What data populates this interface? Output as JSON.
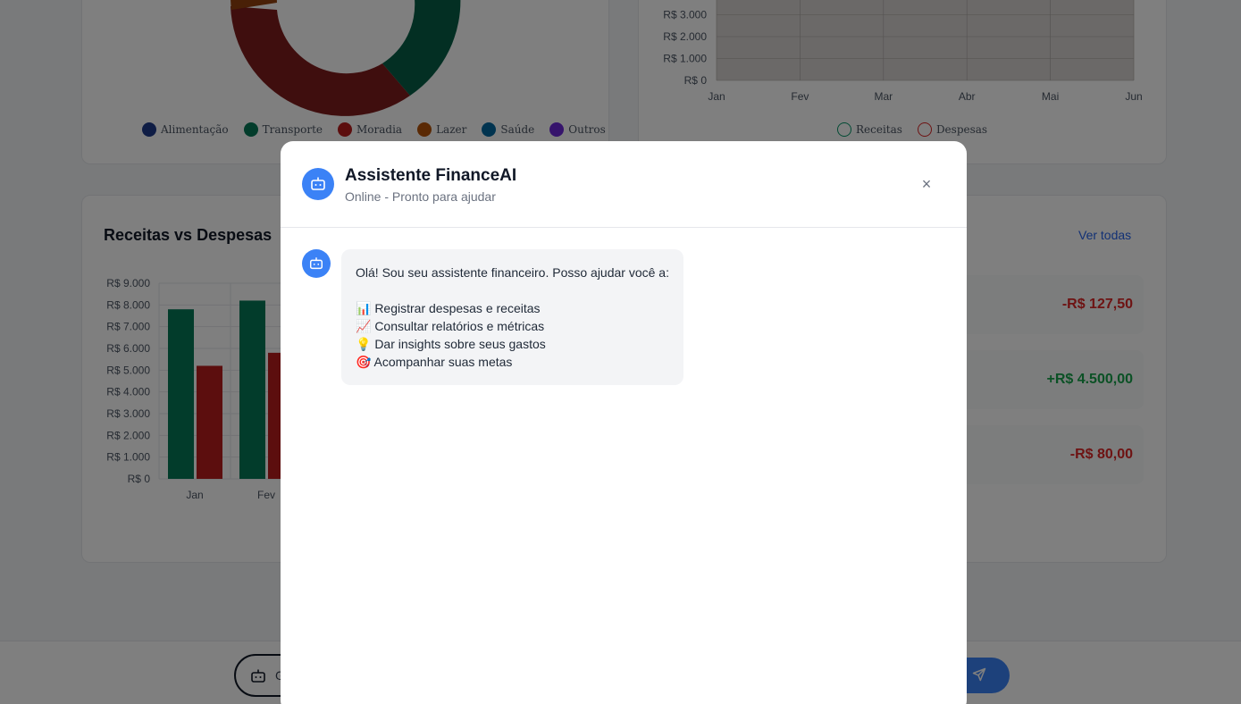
{
  "donut_chart": {
    "legend": [
      {
        "label": "Alimentação",
        "color": "#1e3a8a"
      },
      {
        "label": "Transporte",
        "color": "#047857"
      },
      {
        "label": "Moradia",
        "color": "#b91c1c"
      },
      {
        "label": "Lazer",
        "color": "#b45309"
      },
      {
        "label": "Saúde",
        "color": "#0369a1"
      },
      {
        "label": "Outros",
        "color": "#6d28d9"
      }
    ]
  },
  "area_chart": {
    "y_ticks": [
      "R$ 3.000",
      "R$ 2.000",
      "R$ 1.000",
      "R$ 0"
    ],
    "x_ticks": [
      "Jan",
      "Fev",
      "Mar",
      "Abr",
      "Mai",
      "Jun"
    ],
    "legend": [
      {
        "label": "Receitas",
        "color": "#059669"
      },
      {
        "label": "Despesas",
        "color": "#dc2626"
      }
    ]
  },
  "bar_card": {
    "title": "Receitas vs Despesas",
    "see_all": "Ver todas",
    "transactions": [
      {
        "amount": "-R$ 127,50",
        "kind": "neg"
      },
      {
        "amount": "+R$ 4.500,00",
        "kind": "pos"
      },
      {
        "amount": "-R$ 80,00",
        "kind": "neg"
      }
    ]
  },
  "chart_data": {
    "type": "bar",
    "title": "Receitas vs Despesas",
    "categories": [
      "Jan",
      "Fev"
    ],
    "y_tick_labels": [
      "R$ 9.000",
      "R$ 8.000",
      "R$ 7.000",
      "R$ 6.000",
      "R$ 5.000",
      "R$ 4.000",
      "R$ 3.000",
      "R$ 2.000",
      "R$ 1.000",
      "R$ 0"
    ],
    "ylim": [
      0,
      9000
    ],
    "grid": true,
    "series": [
      {
        "color": "#047857",
        "values": [
          7800,
          8200
        ]
      },
      {
        "color": "#b91c1c",
        "values": [
          5200,
          5800
        ]
      }
    ]
  },
  "bottom_bar": {
    "input_text": "G"
  },
  "modal": {
    "title": "Assistente FinanceAI",
    "subtitle": "Online - Pronto para ajudar",
    "close": "×",
    "message": {
      "intro": "Olá! Sou seu assistente financeiro. Posso ajudar você a:",
      "items": [
        "📊 Registrar despesas e receitas",
        "📈 Consultar relatórios e métricas",
        "💡 Dar insights sobre seus gastos",
        "🎯 Acompanhar suas metas"
      ]
    }
  },
  "colors": {
    "accent": "#3b82f6",
    "income": "#047857",
    "expense": "#b91c1c"
  }
}
